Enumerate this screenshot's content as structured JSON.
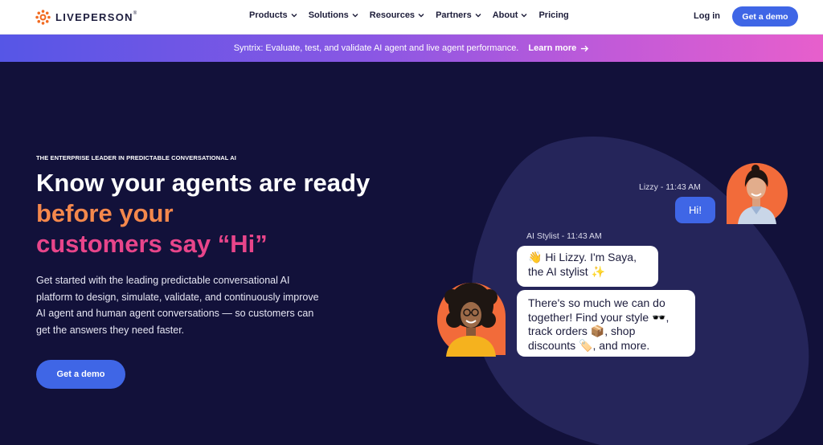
{
  "brand": {
    "name": "LIVEPERSON",
    "mark": "®"
  },
  "nav": {
    "items": [
      {
        "label": "Products",
        "dropdown": true
      },
      {
        "label": "Solutions",
        "dropdown": true
      },
      {
        "label": "Resources",
        "dropdown": true
      },
      {
        "label": "Partners",
        "dropdown": true
      },
      {
        "label": "About",
        "dropdown": true
      },
      {
        "label": "Pricing",
        "dropdown": false
      }
    ],
    "login": "Log in",
    "cta": "Get a demo"
  },
  "banner": {
    "text": "Syntrix: Evaluate, test, and validate AI agent and live agent performance.",
    "link": "Learn more"
  },
  "hero": {
    "eyebrow": "THE ENTERPRISE LEADER IN PREDICTABLE CONVERSATIONAL AI",
    "headline": {
      "part1": "Know your agents are ready ",
      "part2": "before your",
      "part3": "customers say “Hi”"
    },
    "subcopy": "Get started with the leading predictable conversational AI platform to design, simulate, validate, and continuously improve AI agent and human agent conversations — so customers can get the answers they need faster.",
    "cta": "Get a demo"
  },
  "chat": {
    "lizzy_meta": "Lizzy - 11:43 AM",
    "lizzy_msg": "Hi!",
    "ai_meta": "AI Stylist - 11:43 AM",
    "ai_msg1": "👋 Hi Lizzy. I'm Saya, the AI stylist ✨",
    "ai_msg2": "There's so much we can do together! Find your style 🕶️, track orders 📦, shop discounts 🏷️, and more."
  },
  "colors": {
    "hero_bg": "#12113a",
    "blob": "#25255a",
    "primary": "#3f66e6",
    "accent_orange": "#f4884c",
    "accent_pink": "#e8458a"
  }
}
